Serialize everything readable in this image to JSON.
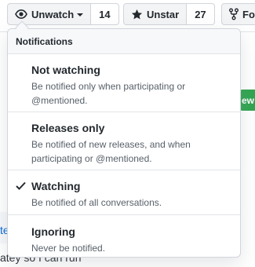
{
  "toolbar": {
    "watch": {
      "label": "Unwatch",
      "count": "14",
      "icon": "eye-icon"
    },
    "star": {
      "label": "Unstar",
      "count": "27",
      "icon": "star-icon"
    },
    "fork": {
      "label": "For",
      "icon": "repo-forked-icon"
    }
  },
  "background": {
    "button_fragment": "ew",
    "link_fragment": "te",
    "text_fragment": "atey so I can run"
  },
  "notifications": {
    "header": "Notifications",
    "selected": "watching",
    "options": [
      {
        "id": "not-watching",
        "title": "Not watching",
        "description": "Be notified only when participating or @mentioned."
      },
      {
        "id": "releases-only",
        "title": "Releases only",
        "description": "Be notified of new releases, and when participating or @mentioned."
      },
      {
        "id": "watching",
        "title": "Watching",
        "description": "Be notified of all conversations."
      },
      {
        "id": "ignoring",
        "title": "Ignoring",
        "description": "Never be notified."
      }
    ]
  },
  "colors": {
    "accent_green": "#2ea44f",
    "link_blue": "#0366d6",
    "border": "#d1d5da"
  }
}
